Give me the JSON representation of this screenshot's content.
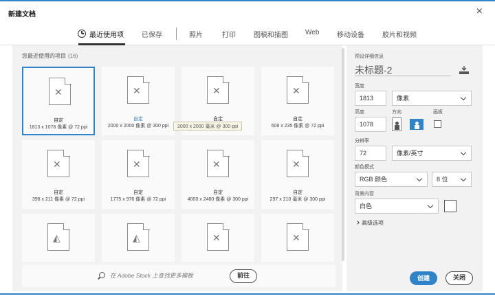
{
  "window": {
    "title": "新建文档",
    "close_label": "×"
  },
  "tabs": [
    {
      "label": "最近使用项",
      "active": true
    },
    {
      "label": "已保存"
    },
    {
      "label": "照片"
    },
    {
      "label": "打印"
    },
    {
      "label": "图稿和插图"
    },
    {
      "label": "Web"
    },
    {
      "label": "移动设备"
    },
    {
      "label": "胶片和视频"
    }
  ],
  "recent": {
    "label": "您最近使用的项目",
    "count": "(16)",
    "items": [
      {
        "name": "自定",
        "size": "1813 x 1078 像素 @ 72 ppi",
        "selected": true,
        "icon": "x"
      },
      {
        "name": "自定",
        "size": "2000 x 2000 像素 @ 300 ppi",
        "icon": "x"
      },
      {
        "name": "自定",
        "size": "2000 x 2000 毫米 @ 300 ppi",
        "icon": "x"
      },
      {
        "name": "自定",
        "size": "608 x 235 像素 @ 72 ppi",
        "icon": "x"
      },
      {
        "name": "自定",
        "size": "398 x 211 像素 @ 72 ppi",
        "icon": "x"
      },
      {
        "name": "自定",
        "size": "1775 x 976 像素 @ 72 ppi",
        "icon": "x"
      },
      {
        "name": "自定",
        "size": "4000 x 2480 像素 @ 300 ppi",
        "icon": "x"
      },
      {
        "name": "自定",
        "size": "297 x 210 毫米 @ 300 ppi",
        "icon": "x"
      },
      {
        "name": "",
        "size": "",
        "icon": "shape"
      },
      {
        "name": "",
        "size": "",
        "icon": "shape"
      },
      {
        "name": "",
        "size": "",
        "icon": "x"
      },
      {
        "name": "",
        "size": "",
        "icon": "x"
      }
    ],
    "tooltip": "2000 x 2000 毫米 @ 300 ppi"
  },
  "stock": {
    "placeholder": "在 Adobe Stock 上查找更多模板",
    "go_label": "前往"
  },
  "preset": {
    "section_label": "预设详细信息",
    "title": "未标题-2",
    "width_label": "宽度",
    "width_value": "1813",
    "width_unit": "像素",
    "height_label": "高度",
    "height_value": "1078",
    "orientation_label": "方向",
    "artboard_label": "画板",
    "resolution_label": "分辨率",
    "resolution_value": "72",
    "resolution_unit": "像素/英寸",
    "color_mode_label": "颜色模式",
    "color_mode_value": "RGB 颜色",
    "bit_depth_value": "8 位",
    "background_label": "背景内容",
    "background_value": "白色",
    "advanced_label": "高级选项"
  },
  "actions": {
    "create_label": "创建",
    "close_label": "关闭"
  },
  "colors": {
    "accent": "#2f83c8",
    "panel": "#f2f2f2"
  }
}
